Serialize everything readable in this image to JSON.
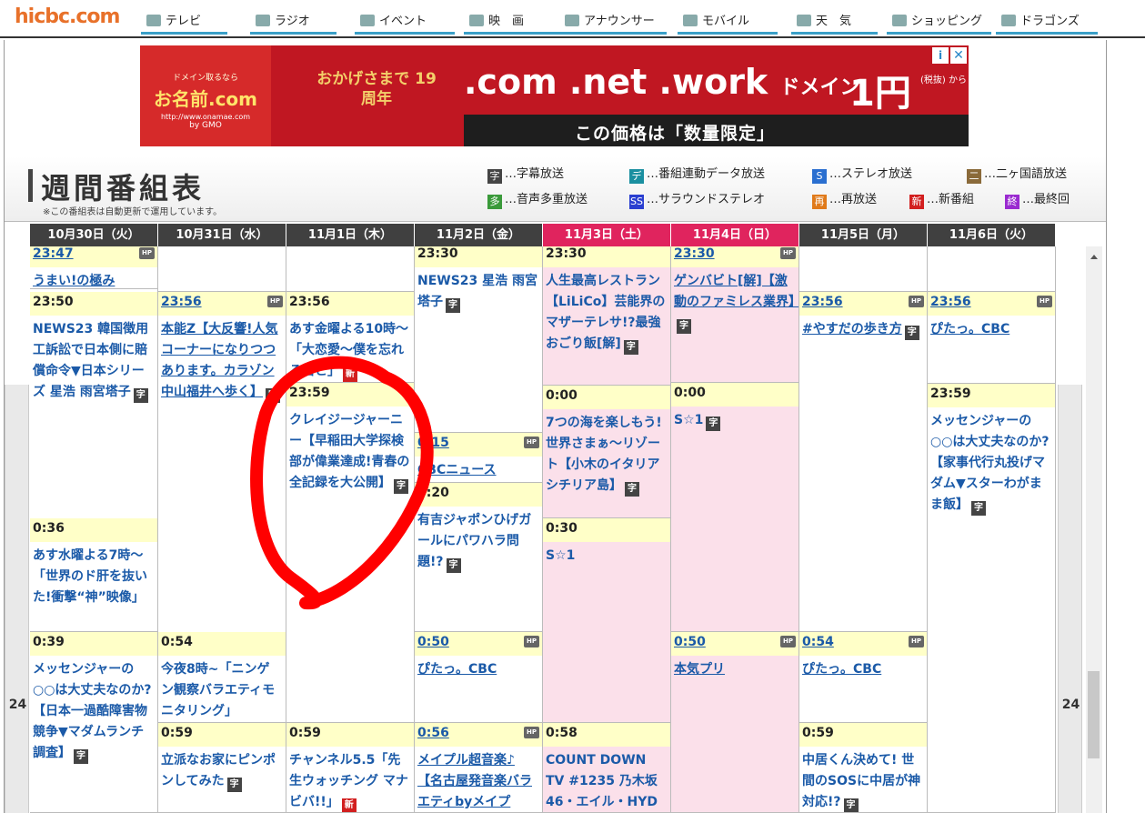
{
  "site": {
    "logo": "hicbc.com",
    "nav": [
      {
        "label": "テレビ",
        "icon": "tv-icon"
      },
      {
        "label": "ラジオ",
        "icon": "radio-icon"
      },
      {
        "label": "イベント",
        "icon": "event-icon"
      },
      {
        "label": "映　画",
        "icon": "movie-icon"
      },
      {
        "label": "アナウンサー",
        "icon": "microphone-icon"
      },
      {
        "label": "モバイル",
        "icon": "mobile-icon"
      },
      {
        "label": "天　気",
        "icon": "sun-icon"
      },
      {
        "label": "ショッピング",
        "icon": "cart-icon"
      },
      {
        "label": "ドラゴンズ",
        "icon": "baseball-icon"
      }
    ],
    "accent": "#3aa0c8"
  },
  "ad": {
    "brand_small": "ドメイン取るなら",
    "brand": "お名前.com",
    "brand_url": "http://www.onamae.com",
    "brand_group": "by GMO",
    "anniversary": "おかげさまで 19周年",
    "domains": ".com .net .work",
    "domain_word": "ドメイン",
    "price": "1円",
    "tax_note": "(税抜) から",
    "limited": "この価格は「数量限定」",
    "info": "i",
    "close": "✕",
    "bg_color": "#c01722"
  },
  "page": {
    "title": "週間番組表",
    "note": "※この番組表は自動更新で運用しています。",
    "legend": [
      {
        "mark": "字",
        "text": "…字幕放送",
        "color": "#444444"
      },
      {
        "mark": "デ",
        "text": "…番組連動データ放送",
        "color": "#1a8fa0"
      },
      {
        "mark": "S",
        "text": "…ステレオ放送",
        "color": "#2a6fd0"
      },
      {
        "mark": "二",
        "text": "…二ヶ国語放送",
        "color": "#8a6a3a"
      },
      {
        "mark": "多",
        "text": "…音声多重放送",
        "color": "#3a9a3a"
      },
      {
        "mark": "SS",
        "text": "…サラウンドステレオ",
        "color": "#2a3fd0"
      },
      {
        "mark": "再",
        "text": "…再放送",
        "color": "#e07a1a"
      },
      {
        "mark": "新",
        "text": "…新番組",
        "color": "#d21f1f"
      },
      {
        "mark": "終",
        "text": "…最終回",
        "color": "#9a2ad0"
      }
    ]
  },
  "schedule": {
    "hour_label": "24",
    "days": [
      {
        "label": "10月30日（火）",
        "kind": "weekday"
      },
      {
        "label": "10月31日（水）",
        "kind": "weekday"
      },
      {
        "label": "11月1日（木）",
        "kind": "weekday"
      },
      {
        "label": "11月2日（金）",
        "kind": "weekday"
      },
      {
        "label": "11月3日（土）",
        "kind": "sat"
      },
      {
        "label": "11月4日（日）",
        "kind": "sun"
      },
      {
        "label": "11月5日（月）",
        "kind": "weekday"
      },
      {
        "label": "11月6日（火）",
        "kind": "weekday"
      }
    ],
    "columns": [
      [
        {
          "time": "23:47",
          "title": "うまい!の極み",
          "hp": true,
          "link": true
        },
        {
          "time": "23:50",
          "title": "NEWS23 韓国徴用工訴訟で日本側に賠償命令▼日本シリーズ 星浩 雨宮塔子",
          "marks": [
            "字"
          ]
        },
        {
          "time": "0:36",
          "title": "あす水曜よる7時～「世界のド肝を抜いた!衝撃“神”映像」"
        },
        {
          "time": "0:39",
          "title": "メッセンジャーの○○は大丈夫なのか?【日本一過酷障害物競争▼マダムランチ調査】",
          "marks": [
            "字"
          ]
        }
      ],
      [
        {
          "time": "",
          "title": ""
        },
        {
          "time": "23:56",
          "title": "本能Z【大反響!人気コーナーになりつつあります。カラゾン中山福井へ歩く】",
          "hp": true,
          "link": true,
          "marks": [
            "字"
          ]
        },
        {
          "time": "0:54",
          "title": "今夜8時~「ニンゲン観察バラエティモニタリング」"
        },
        {
          "time": "0:59",
          "title": "立派なお家にピンポンしてみた",
          "marks": [
            "字"
          ]
        }
      ],
      [
        {
          "time": "",
          "title": ""
        },
        {
          "time": "23:56",
          "title": "あす金曜よる10時～「大恋愛～僕を忘れる君と」",
          "marks": [
            "新"
          ]
        },
        {
          "time": "23:59",
          "title": "クレイジージャーニー【早稲田大学探検部が偉業達成!青春の全記録を大公開】",
          "marks": [
            "字"
          ]
        },
        {
          "time": "0:59",
          "title": "チャンネル5.5「先生ウォッチング マナビバ!!」",
          "marks": [
            "新"
          ]
        }
      ],
      [
        {
          "time": "23:30",
          "title": "NEWS23 星浩 雨宮塔子",
          "marks": [
            "字"
          ]
        },
        {
          "time": "0:15",
          "title": "CBCニュース",
          "hp": true,
          "link": true
        },
        {
          "time": "0:20",
          "title": "有吉ジャポンひげガールにパワハラ問題!?",
          "marks": [
            "字"
          ]
        },
        {
          "time": "0:50",
          "title": "ぴたっ。CBC",
          "hp": true,
          "link": true
        },
        {
          "time": "0:56",
          "title": "メイプル超音楽♪【名古屋発音楽バラエティbyメイプ",
          "hp": true,
          "link": true
        }
      ],
      [
        {
          "time": "23:30",
          "title": "人生最高レストラン【LiLiCo】芸能界のマザーテレサ!?最強おごり飯[解]",
          "marks": [
            "字"
          ]
        },
        {
          "time": "0:00",
          "title": "7つの海を楽しもう!世界さまぁ～リゾート【小木のイタリアシチリア島】",
          "marks": [
            "字"
          ]
        },
        {
          "time": "0:30",
          "title": "S☆1"
        },
        {
          "time": "0:58",
          "title": "COUNT DOWN TV #1235 乃木坂46・エイル・HYD"
        }
      ],
      [
        {
          "time": "23:30",
          "title": "ゲンバビト[解]【激動のファミレス業界】",
          "hp": true,
          "link": true,
          "marks": [
            "字"
          ]
        },
        {
          "time": "0:00",
          "title": "S☆1",
          "marks": [
            "字"
          ]
        },
        {
          "time": "0:50",
          "title": "本気プリ",
          "hp": true,
          "link": true
        }
      ],
      [
        {
          "time": "",
          "title": ""
        },
        {
          "time": "23:56",
          "title": "#やすだの歩き方",
          "hp": true,
          "link": true,
          "marks": [
            "字"
          ]
        },
        {
          "time": "0:54",
          "title": "ぴたっ。CBC",
          "hp": true,
          "link": true
        },
        {
          "time": "0:59",
          "title": "中居くん決めて! 世間のSOSに中居が神対応!?",
          "marks": [
            "字"
          ]
        }
      ],
      [
        {
          "time": "",
          "title": ""
        },
        {
          "time": "23:56",
          "title": "ぴたっ。CBC",
          "hp": true,
          "link": true
        },
        {
          "time": "23:59",
          "title": "メッセンジャーの○○は大丈夫なのか?【家事代行丸投げマダム▼スターわがまま飯】",
          "marks": [
            "字"
          ]
        }
      ]
    ]
  },
  "annotation_color": "#ff0000"
}
